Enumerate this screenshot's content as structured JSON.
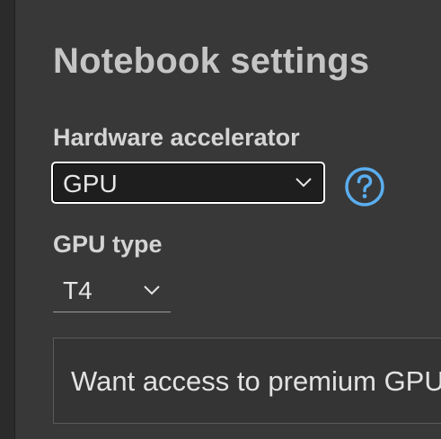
{
  "dialog": {
    "title": "Notebook settings",
    "hardware_accelerator": {
      "label": "Hardware accelerator",
      "selected": "GPU",
      "help_icon": "help-circle-icon"
    },
    "gpu_type": {
      "label": "GPU type",
      "selected": "T4"
    },
    "premium_banner": {
      "text": "Want access to premium GPUs?"
    }
  },
  "colors": {
    "accent": "#5aaeef",
    "background": "#383838",
    "text": "#e6e6e6"
  }
}
